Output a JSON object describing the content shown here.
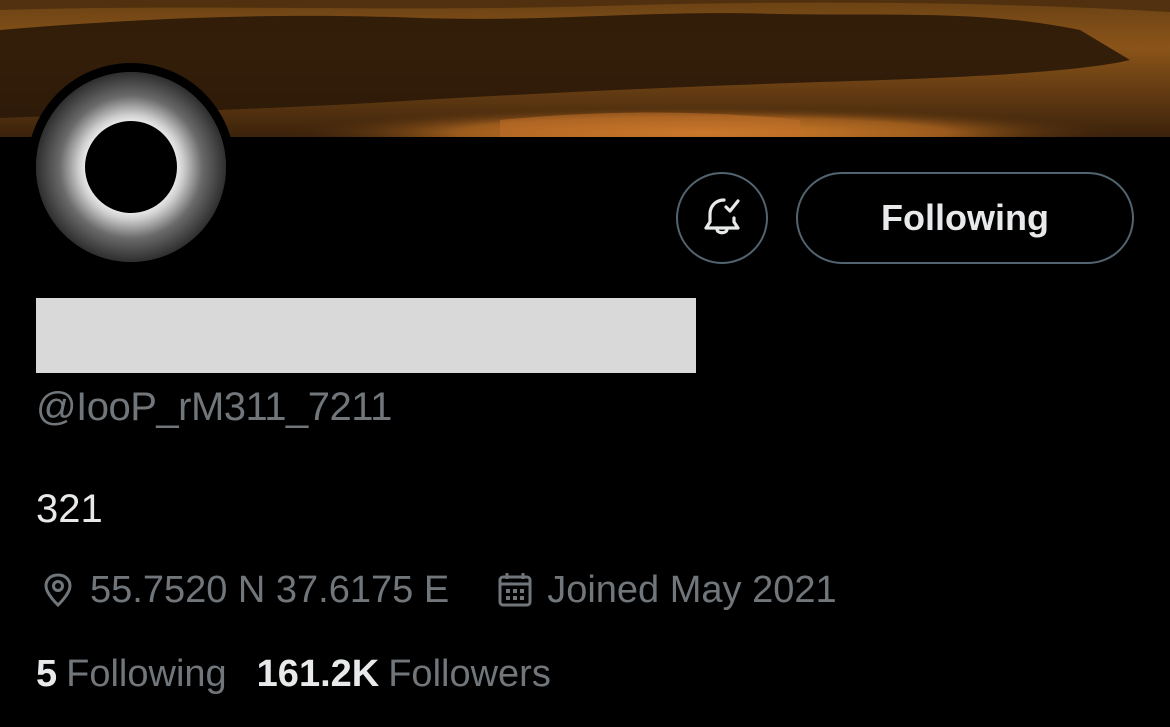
{
  "header": {
    "banner_icon": "sunset-landscape-banner",
    "avatar_icon": "solar-eclipse-avatar"
  },
  "actions": {
    "notifications_icon": "bell-check-icon",
    "following_label": "Following"
  },
  "profile": {
    "display_name_redacted": true,
    "handle": "@IooP_rM311_7211",
    "bio": "321",
    "location": "55.7520 N 37.6175 E",
    "location_icon": "location-pin-icon",
    "joined": "Joined May 2021",
    "joined_icon": "calendar-icon"
  },
  "stats": {
    "following_count": "5",
    "following_label": "Following",
    "followers_count": "161.2K",
    "followers_label": "Followers"
  },
  "colors": {
    "background": "#000000",
    "primary_text": "#e7e9ea",
    "secondary_text": "#71767b",
    "border": "#536471",
    "redaction": "#d9d9d9"
  }
}
